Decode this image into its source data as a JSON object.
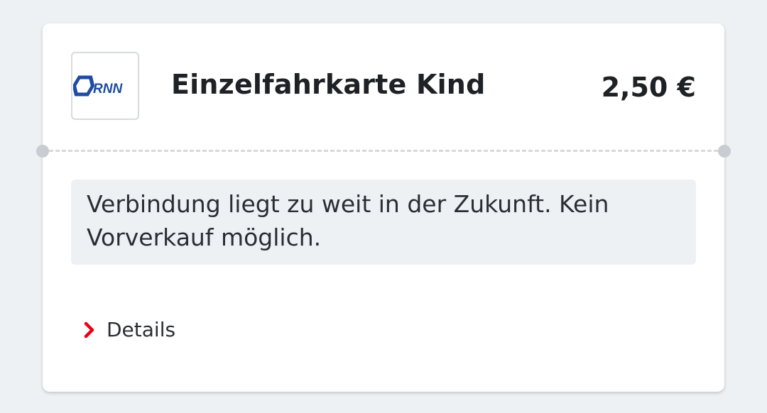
{
  "ticket": {
    "logo_text": "RNN",
    "title": "Einzelfahrkarte Kind",
    "price": "2,50 €"
  },
  "notice": {
    "message": "Verbindung liegt zu weit in der Zukunft. Kein Vorverkauf möglich."
  },
  "details": {
    "label": "Details",
    "icon": "chevron-right-icon"
  },
  "colors": {
    "background": "#eef1f4",
    "card": "#ffffff",
    "accent_red": "#ec0016",
    "logo_blue": "#1d4ca0",
    "text": "#1e2226"
  }
}
